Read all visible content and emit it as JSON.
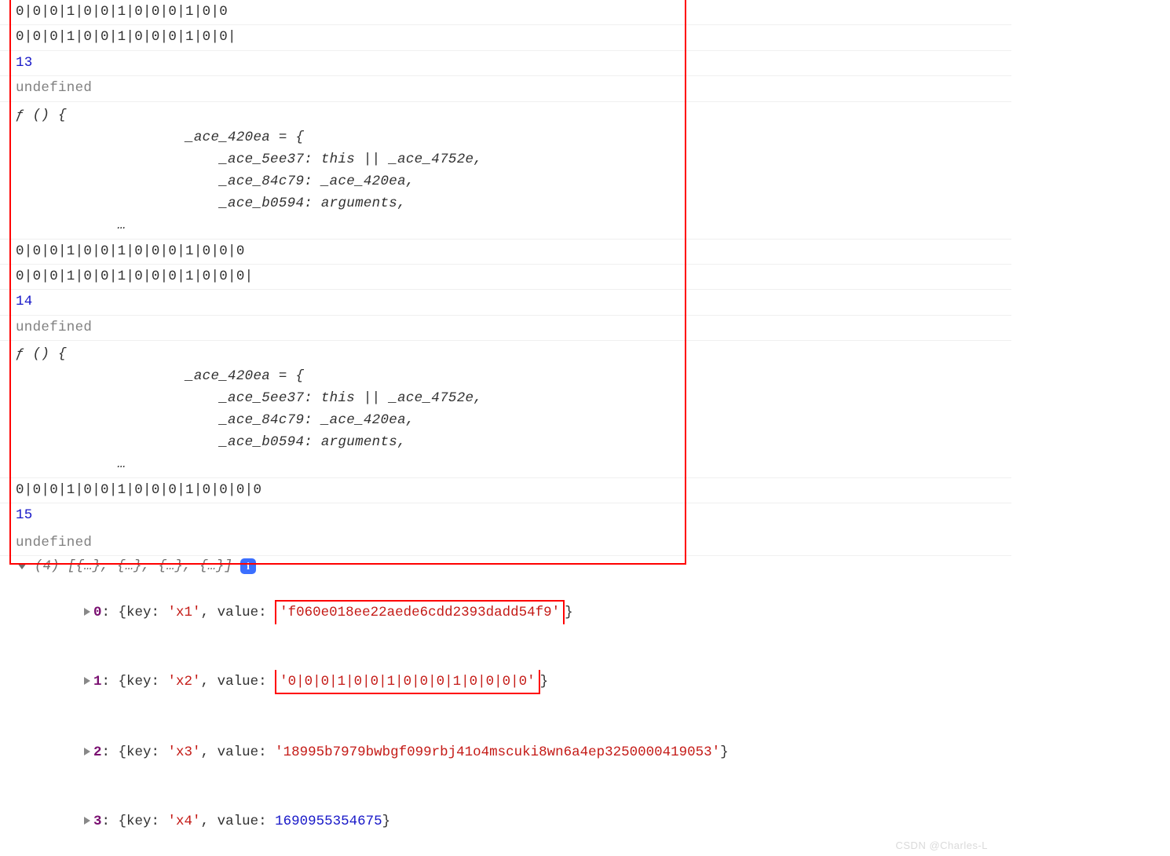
{
  "rows": {
    "bin_cut_top": "0|0|0|1|0|0|1|0|0|0|1|0|0",
    "bin_13a": "0|0|0|1|0|0|1|0|0|0|1|0|0|",
    "num_13": "13",
    "undef_1": "undefined",
    "func_13": "ƒ () {\n                    _ace_420ea = {\n                        _ace_5ee37: this || _ace_4752e,\n                        _ace_84c79: _ace_420ea,\n                        _ace_b0594: arguments,\n            …",
    "bin_14a": "0|0|0|1|0|0|1|0|0|0|1|0|0|0",
    "bin_14b": "0|0|0|1|0|0|1|0|0|0|1|0|0|0|",
    "num_14": "14",
    "undef_2": "undefined",
    "func_14": "ƒ () {\n                    _ace_420ea = {\n                        _ace_5ee37: this || _ace_4752e,\n                        _ace_84c79: _ace_420ea,\n                        _ace_b0594: arguments,\n            …",
    "bin_15a": "0|0|0|1|0|0|1|0|0|0|1|0|0|0|0",
    "num_15": "15",
    "undef_3": "undefined"
  },
  "arr": {
    "summary": "(4) [{…}, {…}, {…}, {…}]",
    "item0_idx": "0",
    "item0_prefix": ": {key: ",
    "item0_key": "'x1'",
    "item0_mid": ", value: ",
    "item0_val": "'f060e018ee22aede6cdd2393dadd54f9'",
    "item1_idx": "1",
    "item1_prefix": ": {key: ",
    "item1_key": "'x2'",
    "item1_mid": ", value: ",
    "item1_val": "'0|0|0|1|0|0|1|0|0|0|1|0|0|0|0'",
    "item2_idx": "2",
    "item2_prefix": ": {key: ",
    "item2_key": "'x3'",
    "item2_mid": ", value: ",
    "item2_val": "'18995b7979bwbgf099rbj41o4mscuki8wn6a4ep3250000419053'",
    "item3_idx": "3",
    "item3_prefix": ": {key: ",
    "item3_key": "'x4'",
    "item3_mid": ", value: ",
    "item3_val": "1690955354675"
  },
  "watermark": "CSDN @Charles-L"
}
